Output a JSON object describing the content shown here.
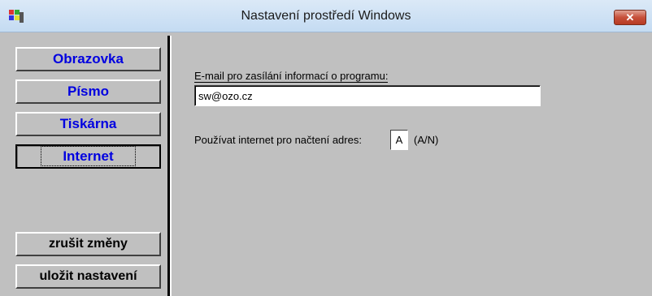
{
  "window": {
    "title": "Nastavení prostředí Windows",
    "close_symbol": "✕"
  },
  "nav": {
    "items": [
      {
        "label": "Obrazovka"
      },
      {
        "label": "Písmo"
      },
      {
        "label": "Tiskárna"
      },
      {
        "label": "Internet",
        "active": true
      }
    ]
  },
  "actions": {
    "discard_label": "zrušit změny",
    "save_label": "uložit nastavení"
  },
  "form": {
    "email_label": "E-mail pro zasílání informací o programu:",
    "email_value": "sw@ozo.cz",
    "internet_label": "Používat internet pro načtení adres:",
    "internet_value": "A",
    "internet_hint": "(A/N)"
  },
  "colors": {
    "nav_text": "#0000e0",
    "panel_bg": "#c0c0c0"
  }
}
